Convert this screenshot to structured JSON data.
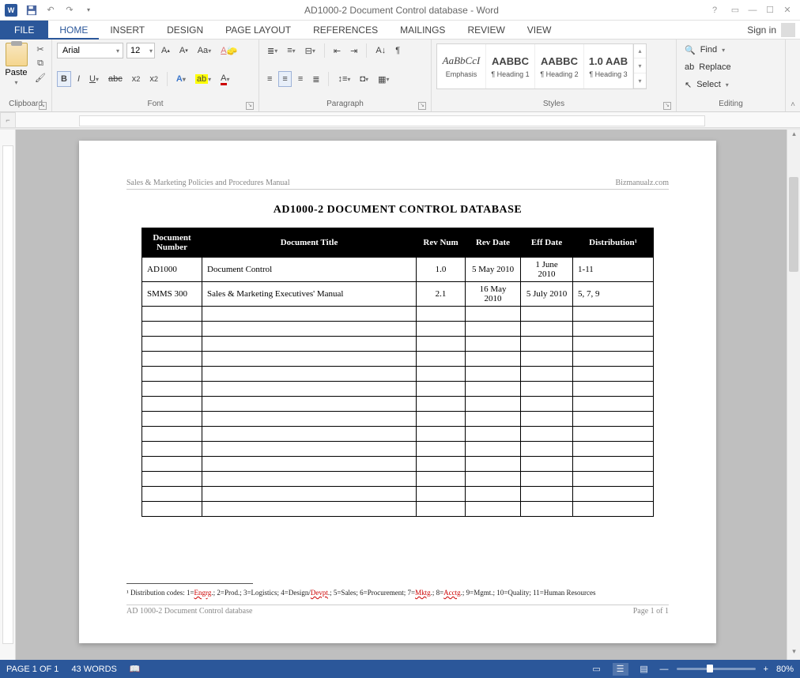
{
  "titlebar": {
    "title": "AD1000-2 Document Control database - Word"
  },
  "tabs": {
    "file": "FILE",
    "items": [
      "HOME",
      "INSERT",
      "DESIGN",
      "PAGE LAYOUT",
      "REFERENCES",
      "MAILINGS",
      "REVIEW",
      "VIEW"
    ],
    "active": 0,
    "signin": "Sign in"
  },
  "ribbon": {
    "clipboard": {
      "paste": "Paste",
      "label": "Clipboard"
    },
    "font": {
      "name": "Arial",
      "size": "12",
      "label": "Font"
    },
    "paragraph": {
      "label": "Paragraph"
    },
    "styles": {
      "label": "Styles",
      "items": [
        {
          "preview": "AaBbCcI",
          "name": "Emphasis",
          "italic": true
        },
        {
          "preview": "AABBC",
          "name": "¶ Heading 1"
        },
        {
          "preview": "AABBC",
          "name": "¶ Heading 2"
        },
        {
          "preview": "1.0 AAB",
          "name": "¶ Heading 3"
        }
      ]
    },
    "editing": {
      "find": "Find",
      "replace": "Replace",
      "select": "Select",
      "label": "Editing"
    }
  },
  "document": {
    "headerLeft": "Sales & Marketing Policies and Procedures Manual",
    "headerRight": "Bizmanualz.com",
    "title": "AD1000-2 DOCUMENT CONTROL DATABASE",
    "columns": [
      "Document Number",
      "Document Title",
      "Rev Num",
      "Rev Date",
      "Eff Date",
      "Distribution¹"
    ],
    "rows": [
      {
        "num": "AD1000",
        "title": "Document Control",
        "rev": "1.0",
        "revdate": "5 May 2010",
        "eff": "1 June 2010",
        "dist": "1-11"
      },
      {
        "num": "SMMS 300",
        "title": "Sales & Marketing Executives' Manual",
        "rev": "2.1",
        "revdate": "16 May 2010",
        "eff": "5 July 2010",
        "dist": "5, 7, 9"
      }
    ],
    "emptyRows": 14,
    "footnote_pre": "¹ Distribution codes: 1=",
    "footnote_a": "Engrg",
    "footnote_b": ".; 2=Prod.; 3=Logistics; 4=Design/",
    "footnote_c": "Devpt",
    "footnote_d": ".; 5=Sales; 6=Procurement; 7=",
    "footnote_e": "Mktg",
    "footnote_f": ".; 8=",
    "footnote_g": "Acctg",
    "footnote_h": ".; 9=Mgmt.; 10=Quality; 11=Human Resources",
    "footerLeft": "AD 1000-2 Document Control database",
    "footerRight": "Page 1 of 1"
  },
  "statusbar": {
    "page": "PAGE 1 OF 1",
    "words": "43 WORDS",
    "zoom": "80%"
  }
}
